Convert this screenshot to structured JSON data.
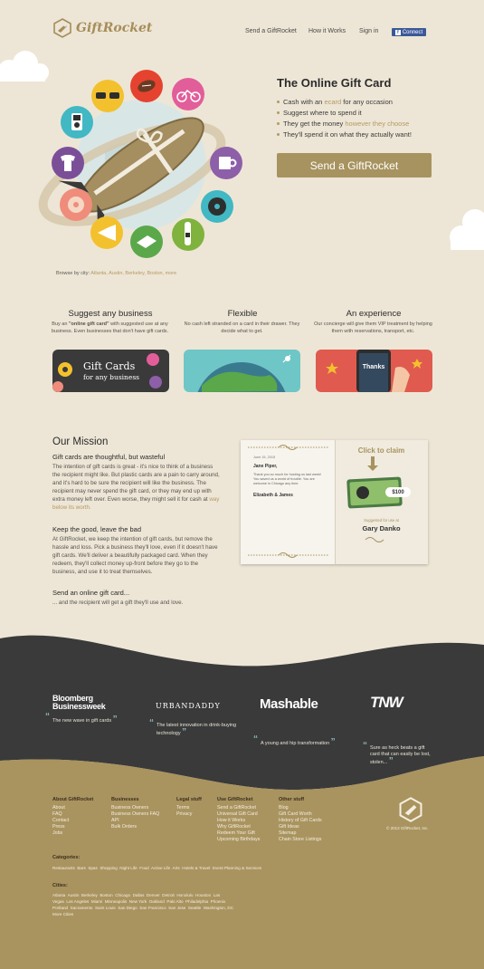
{
  "brand": {
    "name": "GiftRocket"
  },
  "nav": {
    "send": "Send a GiftRocket",
    "how": "How it Works",
    "signin": "Sign in",
    "connect": "Connect"
  },
  "hero": {
    "title": "The Online Gift Card",
    "b1_pre": "Cash with an ",
    "b1_hl": "ecard",
    "b1_post": " for any occasion",
    "b2": "Suggest where to spend it",
    "b3_pre": "They get the money ",
    "b3_hl": "however they choose",
    "b4": "They'll spend it on what they actually want!",
    "cta": "Send a GiftRocket",
    "browse_label": "Browse by city: ",
    "browse_cities": "Atlanta, Austin, Berkeley, Boston, more"
  },
  "features": [
    {
      "title": "Suggest any business",
      "desc_pre": "Buy an ",
      "desc_bold": "\"online gift card\"",
      "desc_post": " with suggested use at any business. Even businesses that don't have gift cards.",
      "card_line1": "Gift Cards",
      "card_line2": "for any business"
    },
    {
      "title": "Flexible",
      "desc": "No cash left stranded on a card in their drawer. They decide what to get."
    },
    {
      "title": "An experience",
      "desc": "Our concierge will give them VIP treatment by helping them with reservations, transport, etc.",
      "card_text": "Thanks"
    }
  ],
  "mission": {
    "title": "Our Mission",
    "h1": "Gift cards are thoughtful, but wasteful",
    "p1": "The intention of gift cards is great - it's nice to think of a business the recipient might like. But plastic cards are a pain to carry around, and it's hard to be sure the recipient will like the business. The recipient may never spend the gift card, or they may end up with extra money left over. Even worse, they might sell it for cash at ",
    "p1_link": "way below its worth.",
    "h2": "Keep the good, leave the bad",
    "p2": "At GiftRocket, we keep the intention of gift cards, but remove the hassle and loss. Pick a business they'll love, even if it doesn't have gift cards. We'll deliver a beautifully packaged card. When they redeem, they'll collect money up-front before they go to the business, and use it to treat themselves.",
    "h3": "Send an online gift card...",
    "p3": "... and the recipient will get a gift they'll use and love."
  },
  "giftcard": {
    "date": "June 15, 2015",
    "to": "Jane Piper,",
    "message": "Thank you so much for hosting us last week! You saved us a world of trouble. You are welcome in Chicago any time.",
    "from": "Elizabeth & James",
    "claim": "Click to claim",
    "amount": "$100",
    "suggested": "Suggested for use at",
    "business": "Gary Danko"
  },
  "press": [
    {
      "logo1": "Bloomberg",
      "logo2": "Businessweek",
      "quote": "The new wave in gift cards"
    },
    {
      "logo1": "URBANDADDY",
      "quote": "The latest innovation in drink-buying technology"
    },
    {
      "logo1": "Mashable",
      "quote": "A young and hip transformation"
    },
    {
      "logo1": "TNW",
      "quote": "Sure as heck beats a gift card that can easily be lost, stolen..."
    }
  ],
  "footer": {
    "cols": [
      {
        "title": "About GiftRocket",
        "items": [
          "About",
          "FAQ",
          "Contact",
          "Press",
          "Jobs"
        ]
      },
      {
        "title": "Businesses",
        "items": [
          "Business Owners",
          "Business Owners FAQ",
          "API",
          "Bulk Orders"
        ]
      },
      {
        "title": "Legal stuff",
        "items": [
          "Terms",
          "Privacy"
        ]
      },
      {
        "title": "Use GiftRocket",
        "items": [
          "Send a GiftRocket",
          "Universal Gift Card",
          "How it Works",
          "Why GiftRocket",
          "Redeem Your Gift",
          "Upcoming Birthdays"
        ]
      },
      {
        "title": "Other stuff",
        "items": [
          "Blog",
          "Gift Card Worth",
          "History of Gift Cards",
          "Gift Ideas",
          "Sitemap",
          "Chain Store Listings"
        ]
      }
    ],
    "copyright": "© 2013 GiftRocket, Inc.",
    "categories_title": "Categories:",
    "categories": "Restaurants  Bars  Spas  Shopping  Night Life  Food  Active Life  Arts  Hotels & Travel  Event Planning & Services",
    "cities_title": "Cities:",
    "cities_l1": "Atlanta  Austin  Berkeley  Boston  Chicago  Dallas  Denver  Detroit  Honolulu  Houston  Las",
    "cities_l2": "Vegas  Los Angeles  Miami  Minneapolis  New York  Oakland  Palo Alto  Philadelphia  Phoenix",
    "cities_l3": "Portland  Sacramento  Saint Louis  San Diego  San Francisco  San Jose  Seattle  Washington, DC",
    "cities_l4": "More Cities"
  },
  "colors": {
    "accent": "#a7935f",
    "dark": "#3a3a3a",
    "footer": "#a9935f",
    "bg": "#ede6d6"
  }
}
